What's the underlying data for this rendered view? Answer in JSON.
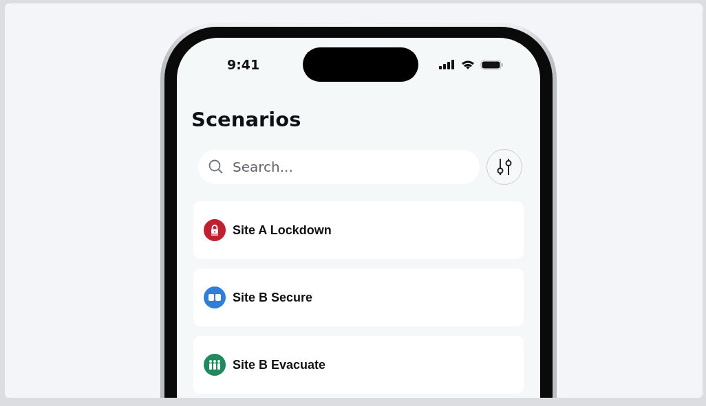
{
  "status_bar": {
    "time": "9:41"
  },
  "title": "Scenarios",
  "search": {
    "placeholder": "Search..."
  },
  "scenarios": [
    {
      "name": "Site A Lockdown",
      "kind": "lockdown",
      "color": "#c0202f"
    },
    {
      "name": "Site B Secure",
      "kind": "secure",
      "color": "#2f7fd8"
    },
    {
      "name": "Site B Evacuate",
      "kind": "evacuate",
      "color": "#1f8a5e"
    }
  ]
}
